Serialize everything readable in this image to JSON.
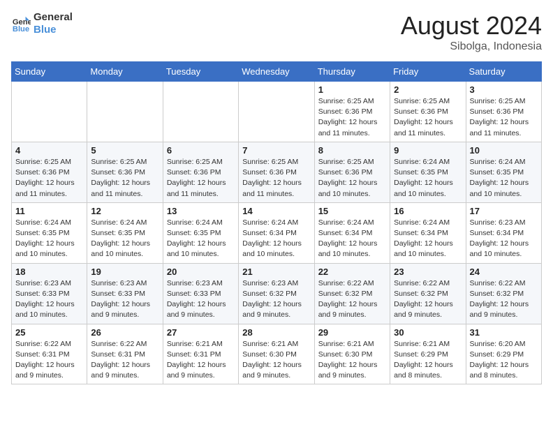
{
  "logo": {
    "line1": "General",
    "line2": "Blue"
  },
  "title": "August 2024",
  "subtitle": "Sibolga, Indonesia",
  "days_of_week": [
    "Sunday",
    "Monday",
    "Tuesday",
    "Wednesday",
    "Thursday",
    "Friday",
    "Saturday"
  ],
  "weeks": [
    [
      {
        "day": "",
        "info": ""
      },
      {
        "day": "",
        "info": ""
      },
      {
        "day": "",
        "info": ""
      },
      {
        "day": "",
        "info": ""
      },
      {
        "day": "1",
        "info": "Sunrise: 6:25 AM\nSunset: 6:36 PM\nDaylight: 12 hours\nand 11 minutes."
      },
      {
        "day": "2",
        "info": "Sunrise: 6:25 AM\nSunset: 6:36 PM\nDaylight: 12 hours\nand 11 minutes."
      },
      {
        "day": "3",
        "info": "Sunrise: 6:25 AM\nSunset: 6:36 PM\nDaylight: 12 hours\nand 11 minutes."
      }
    ],
    [
      {
        "day": "4",
        "info": "Sunrise: 6:25 AM\nSunset: 6:36 PM\nDaylight: 12 hours\nand 11 minutes."
      },
      {
        "day": "5",
        "info": "Sunrise: 6:25 AM\nSunset: 6:36 PM\nDaylight: 12 hours\nand 11 minutes."
      },
      {
        "day": "6",
        "info": "Sunrise: 6:25 AM\nSunset: 6:36 PM\nDaylight: 12 hours\nand 11 minutes."
      },
      {
        "day": "7",
        "info": "Sunrise: 6:25 AM\nSunset: 6:36 PM\nDaylight: 12 hours\nand 11 minutes."
      },
      {
        "day": "8",
        "info": "Sunrise: 6:25 AM\nSunset: 6:36 PM\nDaylight: 12 hours\nand 10 minutes."
      },
      {
        "day": "9",
        "info": "Sunrise: 6:24 AM\nSunset: 6:35 PM\nDaylight: 12 hours\nand 10 minutes."
      },
      {
        "day": "10",
        "info": "Sunrise: 6:24 AM\nSunset: 6:35 PM\nDaylight: 12 hours\nand 10 minutes."
      }
    ],
    [
      {
        "day": "11",
        "info": "Sunrise: 6:24 AM\nSunset: 6:35 PM\nDaylight: 12 hours\nand 10 minutes."
      },
      {
        "day": "12",
        "info": "Sunrise: 6:24 AM\nSunset: 6:35 PM\nDaylight: 12 hours\nand 10 minutes."
      },
      {
        "day": "13",
        "info": "Sunrise: 6:24 AM\nSunset: 6:35 PM\nDaylight: 12 hours\nand 10 minutes."
      },
      {
        "day": "14",
        "info": "Sunrise: 6:24 AM\nSunset: 6:34 PM\nDaylight: 12 hours\nand 10 minutes."
      },
      {
        "day": "15",
        "info": "Sunrise: 6:24 AM\nSunset: 6:34 PM\nDaylight: 12 hours\nand 10 minutes."
      },
      {
        "day": "16",
        "info": "Sunrise: 6:24 AM\nSunset: 6:34 PM\nDaylight: 12 hours\nand 10 minutes."
      },
      {
        "day": "17",
        "info": "Sunrise: 6:23 AM\nSunset: 6:34 PM\nDaylight: 12 hours\nand 10 minutes."
      }
    ],
    [
      {
        "day": "18",
        "info": "Sunrise: 6:23 AM\nSunset: 6:33 PM\nDaylight: 12 hours\nand 10 minutes."
      },
      {
        "day": "19",
        "info": "Sunrise: 6:23 AM\nSunset: 6:33 PM\nDaylight: 12 hours\nand 9 minutes."
      },
      {
        "day": "20",
        "info": "Sunrise: 6:23 AM\nSunset: 6:33 PM\nDaylight: 12 hours\nand 9 minutes."
      },
      {
        "day": "21",
        "info": "Sunrise: 6:23 AM\nSunset: 6:32 PM\nDaylight: 12 hours\nand 9 minutes."
      },
      {
        "day": "22",
        "info": "Sunrise: 6:22 AM\nSunset: 6:32 PM\nDaylight: 12 hours\nand 9 minutes."
      },
      {
        "day": "23",
        "info": "Sunrise: 6:22 AM\nSunset: 6:32 PM\nDaylight: 12 hours\nand 9 minutes."
      },
      {
        "day": "24",
        "info": "Sunrise: 6:22 AM\nSunset: 6:32 PM\nDaylight: 12 hours\nand 9 minutes."
      }
    ],
    [
      {
        "day": "25",
        "info": "Sunrise: 6:22 AM\nSunset: 6:31 PM\nDaylight: 12 hours\nand 9 minutes."
      },
      {
        "day": "26",
        "info": "Sunrise: 6:22 AM\nSunset: 6:31 PM\nDaylight: 12 hours\nand 9 minutes."
      },
      {
        "day": "27",
        "info": "Sunrise: 6:21 AM\nSunset: 6:31 PM\nDaylight: 12 hours\nand 9 minutes."
      },
      {
        "day": "28",
        "info": "Sunrise: 6:21 AM\nSunset: 6:30 PM\nDaylight: 12 hours\nand 9 minutes."
      },
      {
        "day": "29",
        "info": "Sunrise: 6:21 AM\nSunset: 6:30 PM\nDaylight: 12 hours\nand 9 minutes."
      },
      {
        "day": "30",
        "info": "Sunrise: 6:21 AM\nSunset: 6:29 PM\nDaylight: 12 hours\nand 8 minutes."
      },
      {
        "day": "31",
        "info": "Sunrise: 6:20 AM\nSunset: 6:29 PM\nDaylight: 12 hours\nand 8 minutes."
      }
    ]
  ],
  "colors": {
    "header_bg": "#3a6fc4",
    "header_text": "#ffffff",
    "row_alt": "#f5f7fa"
  }
}
